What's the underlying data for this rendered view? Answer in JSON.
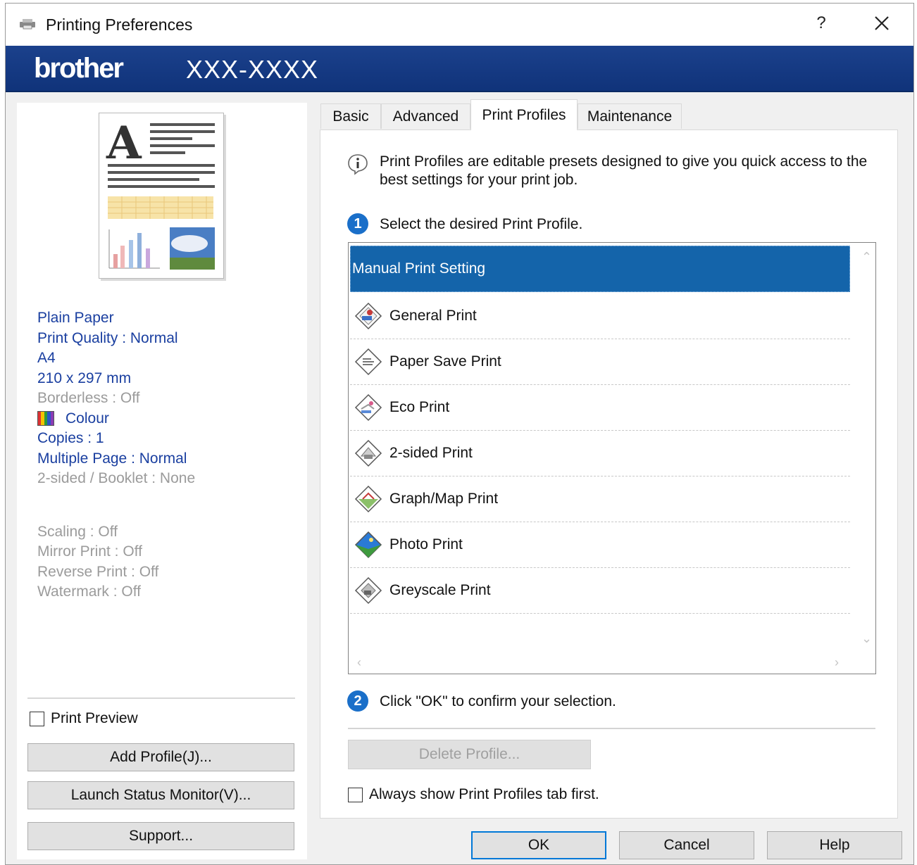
{
  "window": {
    "title": "Printing Preferences",
    "help_glyph": "?",
    "icons": {
      "app": "printer-icon",
      "close": "close-icon"
    }
  },
  "banner": {
    "logo": "brother",
    "model": "XXX-XXXX"
  },
  "summary": {
    "media": "Plain Paper",
    "quality": "Print Quality : Normal",
    "size": "A4",
    "dimensions": "210 x 297 mm",
    "borderless": "Borderless : Off",
    "colour": "Colour",
    "copies": "Copies : 1",
    "multiple_page": "Multiple Page : Normal",
    "two_sided": "2-sided / Booklet : None",
    "scaling": "Scaling : Off",
    "mirror": "Mirror Print : Off",
    "reverse": "Reverse Print : Off",
    "watermark": "Watermark : Off"
  },
  "left_controls": {
    "print_preview_label": "Print Preview",
    "print_preview_checked": false,
    "add_profile": "Add Profile(J)...",
    "launch_status_monitor": "Launch Status Monitor(V)...",
    "support": "Support..."
  },
  "tabs": [
    {
      "label": "Basic",
      "active": false
    },
    {
      "label": "Advanced",
      "active": false
    },
    {
      "label": "Print Profiles",
      "active": true
    },
    {
      "label": "Maintenance",
      "active": false
    }
  ],
  "print_profiles": {
    "info_text": "Print Profiles are editable presets designed to give you quick access to the best settings for your print job.",
    "step1_number": "1",
    "step1_text": "Select the desired Print Profile.",
    "profiles": [
      {
        "label": "Manual Print Setting",
        "selected": true,
        "icon": ""
      },
      {
        "label": "General Print",
        "selected": false,
        "icon": "general-print-icon"
      },
      {
        "label": "Paper Save Print",
        "selected": false,
        "icon": "paper-save-print-icon"
      },
      {
        "label": "Eco Print",
        "selected": false,
        "icon": "eco-print-icon"
      },
      {
        "label": "2-sided Print",
        "selected": false,
        "icon": "two-sided-print-icon"
      },
      {
        "label": "Graph/Map Print",
        "selected": false,
        "icon": "graph-map-print-icon"
      },
      {
        "label": "Photo Print",
        "selected": false,
        "icon": "photo-print-icon"
      },
      {
        "label": "Greyscale Print",
        "selected": false,
        "icon": "greyscale-print-icon"
      }
    ],
    "step2_number": "2",
    "step2_text": "Click \"OK\" to confirm your selection.",
    "delete_profile": "Delete Profile...",
    "always_show_label": "Always show Print Profiles tab first.",
    "always_show_checked": false
  },
  "footer": {
    "ok": "OK",
    "cancel": "Cancel",
    "help": "Help"
  },
  "colors": {
    "banner": "#1b418c",
    "selection": "#1464aa",
    "summary_text": "#1a3fa0",
    "summary_disabled": "#9b9b9b",
    "step_badge": "#1a6fc9"
  }
}
